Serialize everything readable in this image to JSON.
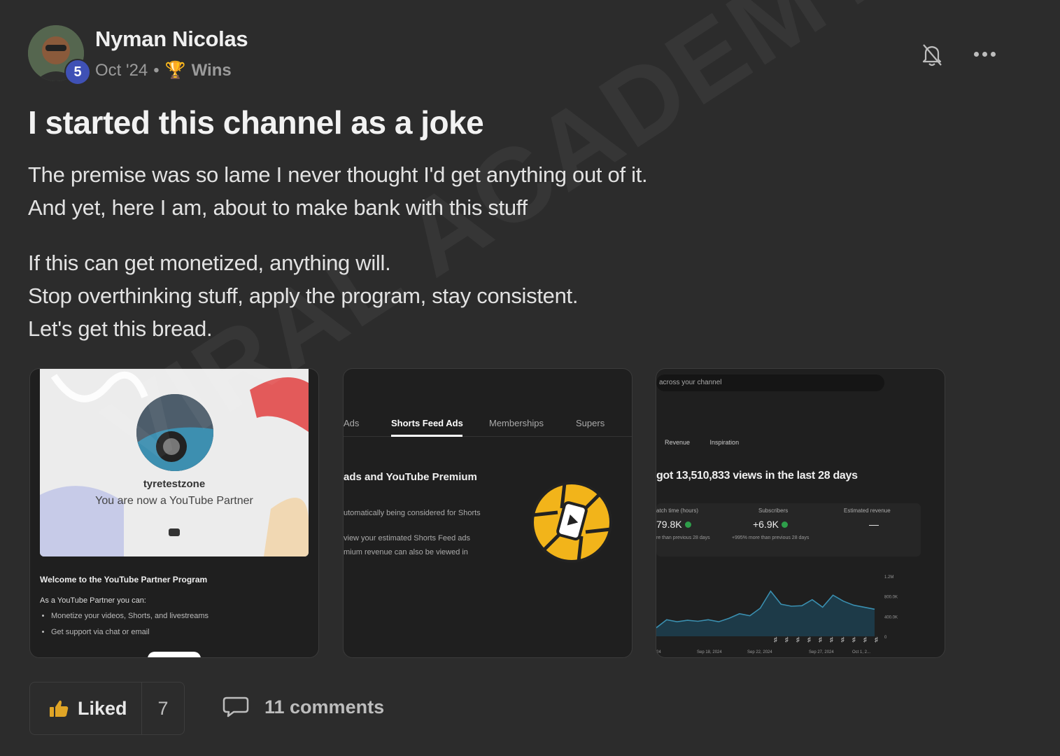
{
  "post": {
    "author": "Nyman Nicolas",
    "level": "5",
    "date": "Oct '24",
    "separator": "•",
    "category": "Wins",
    "title": "I started this channel as a joke",
    "body": [
      "The premise was so lame I never thought I'd get anything out of it.",
      "And yet, here I am, about to make bank with this stuff",
      "If this can get monetized, anything will.",
      "Stop overthinking stuff, apply the program, stay consistent.",
      "Let's get this bread."
    ]
  },
  "images": {
    "partner_card": {
      "channel": "tyretestzone",
      "status": "You are now a YouTube Partner",
      "welcome": "Welcome to the YouTube Partner Program",
      "can": "As a YouTube Partner you can:",
      "bullets": [
        "Monetize your videos, Shorts, and livestreams",
        "Get support via chat or email"
      ]
    },
    "shorts_card": {
      "tabs": [
        "Ads",
        "Shorts Feed Ads",
        "Memberships",
        "Supers"
      ],
      "heading": "ads and YouTube Premium",
      "line1": "utomatically being considered for Shorts",
      "line2": "view your estimated Shorts Feed ads",
      "line3": "mium revenue can also be viewed in"
    },
    "analytics_card": {
      "search": "across your channel",
      "tabs": [
        "Revenue",
        "Inspiration"
      ],
      "headline": "got 13,510,833 views in the last 28 days",
      "stats": [
        {
          "label": "atch time (hours)",
          "value": "79.8K",
          "sub": "re than previous 28 days"
        },
        {
          "label": "Subscribers",
          "value": "+6.9K",
          "sub": "+995% more than previous 28 days"
        },
        {
          "label": "Estimated revenue",
          "value": "—",
          "sub": ""
        }
      ],
      "y_ticks": [
        "1.2M",
        "800.0K",
        "400.0K",
        "0"
      ],
      "x_ticks": [
        "24",
        "Sep 18, 2024",
        "Sep 22, 2024",
        "Sep 27, 2024",
        "Oct 1, 2..."
      ]
    }
  },
  "chart_data": {
    "type": "area",
    "title": "",
    "xlabel": "",
    "ylabel": "",
    "ylim": [
      0,
      1200000
    ],
    "y_ticks": [
      "1.2M",
      "800.0K",
      "400.0K",
      "0"
    ],
    "x_ticks": [
      "24",
      "Sep 18, 2024",
      "Sep 22, 2024",
      "Sep 27, 2024",
      "Oct 1, 2..."
    ],
    "series": [
      {
        "values": [
          170000,
          330000,
          290000,
          320000,
          300000,
          330000,
          290000,
          360000,
          450000,
          410000,
          560000,
          900000,
          640000,
          600000,
          610000,
          730000,
          580000,
          820000,
          700000,
          620000,
          580000,
          540000
        ]
      }
    ]
  },
  "actions": {
    "like_label": "Liked",
    "like_count": "7",
    "comments_label": "11 comments"
  },
  "watermark": "VIRAL ACADEMY",
  "colors": {
    "background": "#2c2c2c",
    "level_badge": "#3f51b5",
    "like_icon": "#e0a526",
    "chart_line": "#3a8fb0",
    "positive_dot": "#2e9e4a"
  }
}
